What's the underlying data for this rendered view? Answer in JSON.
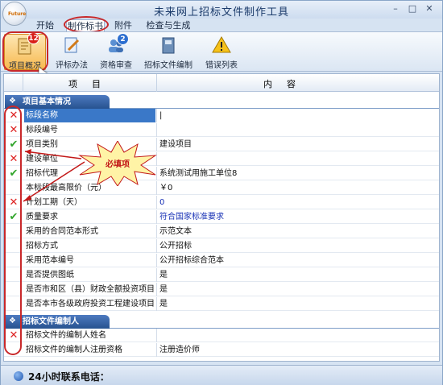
{
  "window": {
    "title": "未来网上招标文件制作工具",
    "logo_text": "Future"
  },
  "menu": [
    {
      "label": "开始",
      "active": false
    },
    {
      "label": "制作标书",
      "active": true
    },
    {
      "label": "附件",
      "active": false
    },
    {
      "label": "检查与生成",
      "active": false
    }
  ],
  "ribbon": [
    {
      "label": "项目概况",
      "icon": "document-edit-icon",
      "active": true,
      "badge": "12"
    },
    {
      "label": "评标办法",
      "icon": "pencil-icon",
      "active": false
    },
    {
      "label": "资格审查",
      "icon": "people-icon",
      "active": false,
      "badge": "2"
    },
    {
      "label": "招标文件编制",
      "icon": "book-icon",
      "active": false
    },
    {
      "label": "错误列表",
      "icon": "warning-icon",
      "active": false
    }
  ],
  "grid": {
    "col_item": "项目",
    "col_content": "内容",
    "sections": [
      {
        "title": "项目基本情况",
        "rows": [
          {
            "label": "标段名称",
            "value": "|",
            "status": "x",
            "selected": true
          },
          {
            "label": "标段编号",
            "value": "",
            "status": "x"
          },
          {
            "label": "项目类别",
            "value": "建设项目",
            "status": "ok"
          },
          {
            "label": "建设单位",
            "value": "",
            "status": "x"
          },
          {
            "label": "招标代理",
            "value": "系统测试用施工单位8",
            "status": "ok"
          },
          {
            "label": "本标段最高限价（元）",
            "value": "￥0",
            "status": ""
          },
          {
            "label": "计划工期（天）",
            "value": "0",
            "status": "x",
            "blue": true
          },
          {
            "label": "质量要求",
            "value": "符合国家标准要求",
            "status": "ok",
            "blue": true
          },
          {
            "label": "采用的合同范本形式",
            "value": "示范文本",
            "status": ""
          },
          {
            "label": "招标方式",
            "value": "公开招标",
            "status": ""
          },
          {
            "label": "采用范本编号",
            "value": "公开招标综合范本",
            "status": ""
          },
          {
            "label": "是否提供图纸",
            "value": "是",
            "status": ""
          },
          {
            "label": "是否市和区（县）财政全额投资项目",
            "value": "是",
            "status": ""
          },
          {
            "label": "是否本市各级政府投资工程建设项目",
            "value": "是",
            "status": ""
          }
        ]
      },
      {
        "title": "招标文件编制人",
        "rows": [
          {
            "label": "招标文件的编制人姓名",
            "value": "",
            "status": "x"
          },
          {
            "label": "招标文件的编制人注册资格",
            "value": "注册造价师",
            "status": ""
          }
        ]
      }
    ]
  },
  "callout": {
    "text": "必填项"
  },
  "statusbar": {
    "text": "24小时联系电话："
  },
  "colors": {
    "error": "#dd2222",
    "ok": "#32a52c",
    "section": "#27528f",
    "highlight": "#c8282a",
    "selected": "#3a78c8"
  }
}
